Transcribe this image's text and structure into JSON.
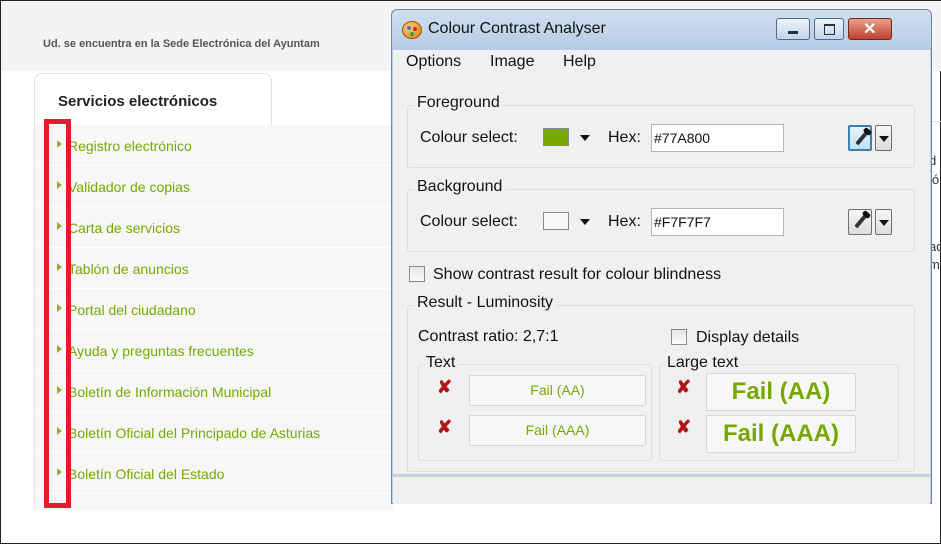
{
  "page": {
    "location_text": "Ud. se encuentra en la Sede Electrónica del Ayuntam",
    "tab_label": "Servicios electrónicos",
    "menu_items": [
      {
        "label": "Registro electrónico"
      },
      {
        "label": "Validador de copias"
      },
      {
        "label": "Carta de servicios"
      },
      {
        "label": "Tablón de anuncios"
      },
      {
        "label": "Portal del ciudadano"
      },
      {
        "label": "Ayuda y preguntas frecuentes"
      },
      {
        "label": "Boletín de Información Municipal"
      },
      {
        "label": "Boletín Oficial del Principado de Asturias"
      },
      {
        "label": "Boletín Oficial del Estado"
      }
    ],
    "right_fragments": [
      "d",
      "ló",
      "ad",
      "m"
    ],
    "link_color": "#77A800",
    "highlight_color": "#e01d2a"
  },
  "dialog": {
    "title": "Colour Contrast Analyser",
    "app_icon": "palette-icon",
    "menu": [
      "Options",
      "Image",
      "Help"
    ],
    "foreground": {
      "title": "Foreground",
      "colour_select_label": "Colour select:",
      "swatch_color": "#77A800",
      "hex_label": "Hex:",
      "hex_value": "#77A800"
    },
    "background": {
      "title": "Background",
      "colour_select_label": "Colour select:",
      "swatch_color": "#F7F7F7",
      "hex_label": "Hex:",
      "hex_value": "#F7F7F7"
    },
    "colour_blindness_label": "Show contrast result for colour blindness",
    "result": {
      "title": "Result - Luminosity",
      "contrast_ratio": "Contrast ratio: 2,7:1",
      "display_details": "Display details",
      "text_group": "Text",
      "large_text_group": "Large text",
      "text_aa": "Fail (AA)",
      "text_aaa": "Fail (AAA)",
      "large_aa": "Fail (AA)",
      "large_aaa": "Fail (AAA)",
      "fail_mark": "✘"
    },
    "window_buttons": {
      "minimize": "minimize-icon",
      "maximize": "maximize-icon",
      "close": "close-icon",
      "close_glyph": "✕"
    }
  }
}
